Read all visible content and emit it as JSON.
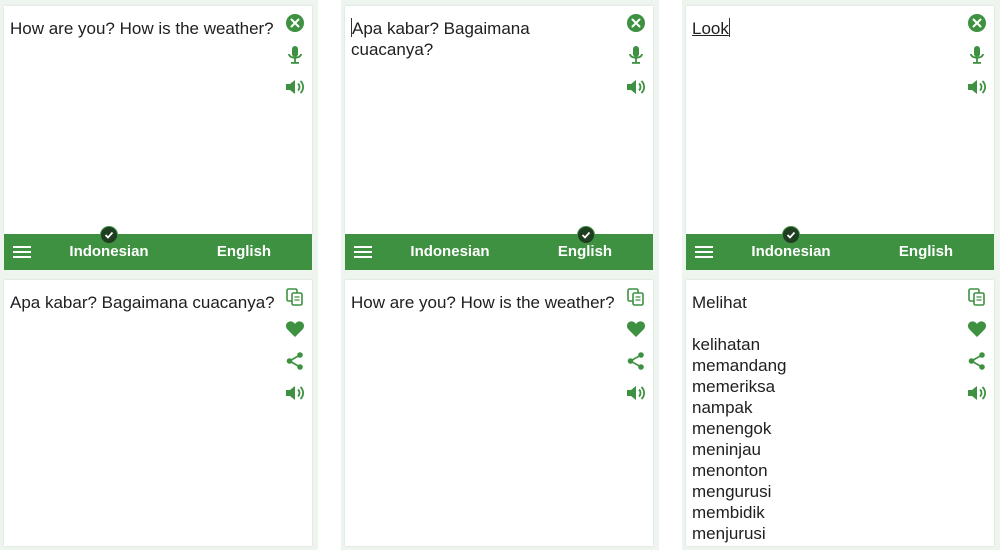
{
  "accent_color": "#3d9140",
  "screens": [
    {
      "input_text": "How are you? How is the weather?",
      "source_lang": "Indonesian",
      "target_lang": "English",
      "selected": "source",
      "output_main": "Apa kabar? Bagaimana cuacanya?",
      "output_alternatives": []
    },
    {
      "input_text": "Apa kabar? Bagaimana cuacanya?",
      "source_lang": "Indonesian",
      "target_lang": "English",
      "selected": "target",
      "output_main": "How are you? How is the weather?",
      "output_alternatives": []
    },
    {
      "input_text": "Look",
      "source_lang": "Indonesian",
      "target_lang": "English",
      "selected": "source",
      "output_main": "Melihat",
      "output_alternatives": [
        "kelihatan",
        "memandang",
        "memeriksa",
        "nampak",
        "menengok",
        "meninjau",
        "menonton",
        "mengurusi",
        "membidik",
        "menjurusi"
      ]
    }
  ],
  "icons": {
    "clear": "close-circle-icon",
    "mic": "microphone-icon",
    "speak": "speaker-icon",
    "copy": "copy-icon",
    "favorite": "heart-icon",
    "share": "share-icon",
    "menu": "hamburger-icon",
    "check": "check-badge-icon"
  }
}
